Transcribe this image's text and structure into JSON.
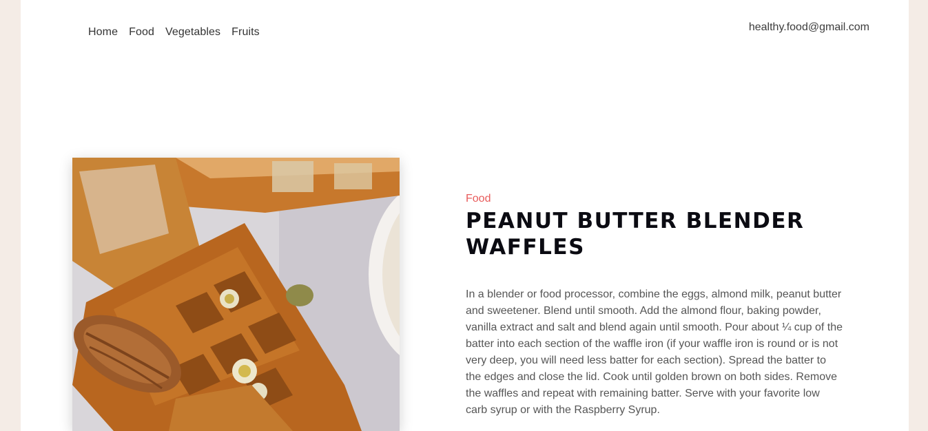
{
  "nav": {
    "items": [
      {
        "label": "Home"
      },
      {
        "label": "Food"
      },
      {
        "label": "Vegetables"
      },
      {
        "label": "Fruits"
      }
    ]
  },
  "header": {
    "email": "healthy.food@gmail.com"
  },
  "article": {
    "category": "Food",
    "title": "Peanut Butter Blender Waffles",
    "body": "In a blender or food processor, combine the eggs, almond milk, peanut butter and sweetener. Blend until smooth. Add the almond flour, baking powder, vanilla extract and salt and blend again until smooth. Pour about ¼ cup of the batter into each section of the waffle iron (if your waffle iron is round or is not very deep, you will need less batter for each section). Spread the batter to the edges and close the lid. Cook until golden brown on both sides. Remove the waffles and repeat with remaining batter. Serve with your favorite low carb syrup or with the Raspberry Syrup."
  },
  "colors": {
    "page_background": "#f4ece6",
    "content_background": "#ffffff",
    "category_accent": "#e85b5b",
    "title": "#0b0b12",
    "body_text": "#555555"
  },
  "image": {
    "icon": "waffle-photo"
  }
}
